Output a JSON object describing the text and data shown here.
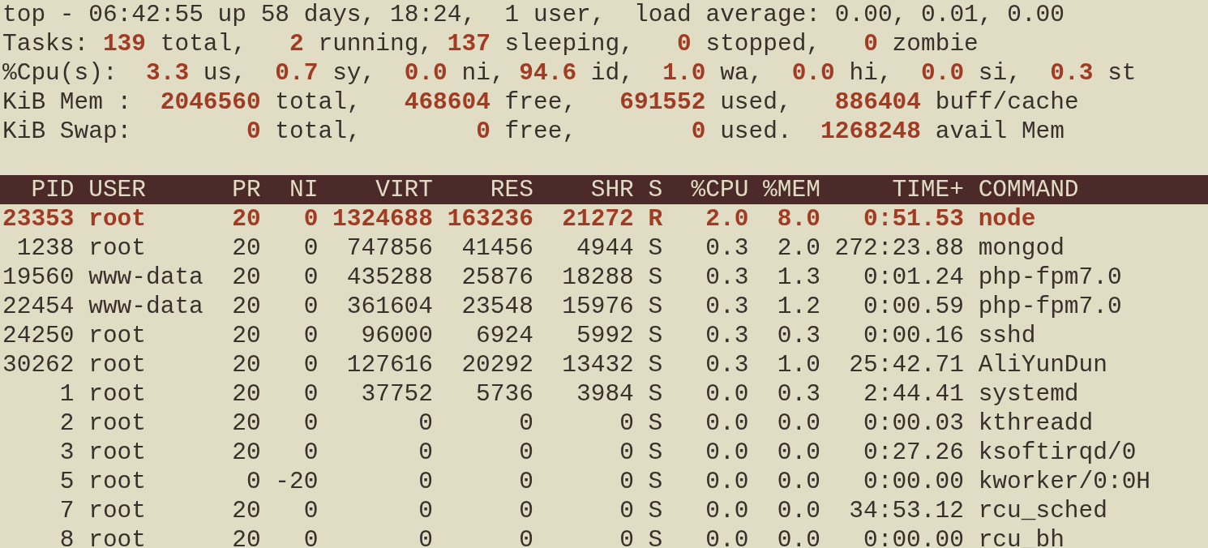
{
  "summary": [
    "top - 06:42:55 up 58 days, 18:24,  1 user,  load average: 0.00, 0.01, 0.00",
    "Tasks: **139** total,   **2** running, **137** sleeping,   **0** stopped,   **0** zombie",
    "%Cpu(s):  **3.3** us,  **0.7** sy,  **0.0** ni, **94.6** id,  **1.0** wa,  **0.0** hi,  **0.0** si,  **0.3** st",
    "KiB Mem :  **2046560** total,   **468604** free,   **691552** used,   **886404** buff/cache",
    "KiB Swap:        **0** total,        **0** free,        **0** used.  **1268248** avail Mem"
  ],
  "table": {
    "columns": [
      "PID",
      "USER",
      "PR",
      "NI",
      "VIRT",
      "RES",
      "SHR",
      "S",
      "%CPU",
      "%MEM",
      "TIME+",
      "COMMAND"
    ],
    "rows": [
      {
        "highlighted": true,
        "cells": [
          "23353",
          "root",
          "20",
          "0",
          "1324688",
          "163236",
          "21272",
          "R",
          "2.0",
          "8.0",
          "0:51.53",
          "node"
        ]
      },
      {
        "highlighted": false,
        "cells": [
          "1238",
          "root",
          "20",
          "0",
          "747856",
          "41456",
          "4944",
          "S",
          "0.3",
          "2.0",
          "272:23.88",
          "mongod"
        ]
      },
      {
        "highlighted": false,
        "cells": [
          "19560",
          "www-data",
          "20",
          "0",
          "435288",
          "25876",
          "18288",
          "S",
          "0.3",
          "1.3",
          "0:01.24",
          "php-fpm7.0"
        ]
      },
      {
        "highlighted": false,
        "cells": [
          "22454",
          "www-data",
          "20",
          "0",
          "361604",
          "23548",
          "15976",
          "S",
          "0.3",
          "1.2",
          "0:00.59",
          "php-fpm7.0"
        ]
      },
      {
        "highlighted": false,
        "cells": [
          "24250",
          "root",
          "20",
          "0",
          "96000",
          "6924",
          "5992",
          "S",
          "0.3",
          "0.3",
          "0:00.16",
          "sshd"
        ]
      },
      {
        "highlighted": false,
        "cells": [
          "30262",
          "root",
          "20",
          "0",
          "127616",
          "20292",
          "13432",
          "S",
          "0.3",
          "1.0",
          "25:42.71",
          "AliYunDun"
        ]
      },
      {
        "highlighted": false,
        "cells": [
          "1",
          "root",
          "20",
          "0",
          "37752",
          "5736",
          "3984",
          "S",
          "0.0",
          "0.3",
          "2:44.41",
          "systemd"
        ]
      },
      {
        "highlighted": false,
        "cells": [
          "2",
          "root",
          "20",
          "0",
          "0",
          "0",
          "0",
          "S",
          "0.0",
          "0.0",
          "0:00.03",
          "kthreadd"
        ]
      },
      {
        "highlighted": false,
        "cells": [
          "3",
          "root",
          "20",
          "0",
          "0",
          "0",
          "0",
          "S",
          "0.0",
          "0.0",
          "0:27.26",
          "ksoftirqd/0"
        ]
      },
      {
        "highlighted": false,
        "cells": [
          "5",
          "root",
          "0",
          "-20",
          "0",
          "0",
          "0",
          "S",
          "0.0",
          "0.0",
          "0:00.00",
          "kworker/0:0H"
        ]
      },
      {
        "highlighted": false,
        "cells": [
          "7",
          "root",
          "20",
          "0",
          "0",
          "0",
          "0",
          "S",
          "0.0",
          "0.0",
          "34:53.12",
          "rcu_sched"
        ]
      },
      {
        "highlighted": false,
        "cells": [
          "8",
          "root",
          "20",
          "0",
          "0",
          "0",
          "0",
          "S",
          "0.0",
          "0.0",
          "0:00.00",
          "rcu_bh"
        ]
      }
    ]
  }
}
